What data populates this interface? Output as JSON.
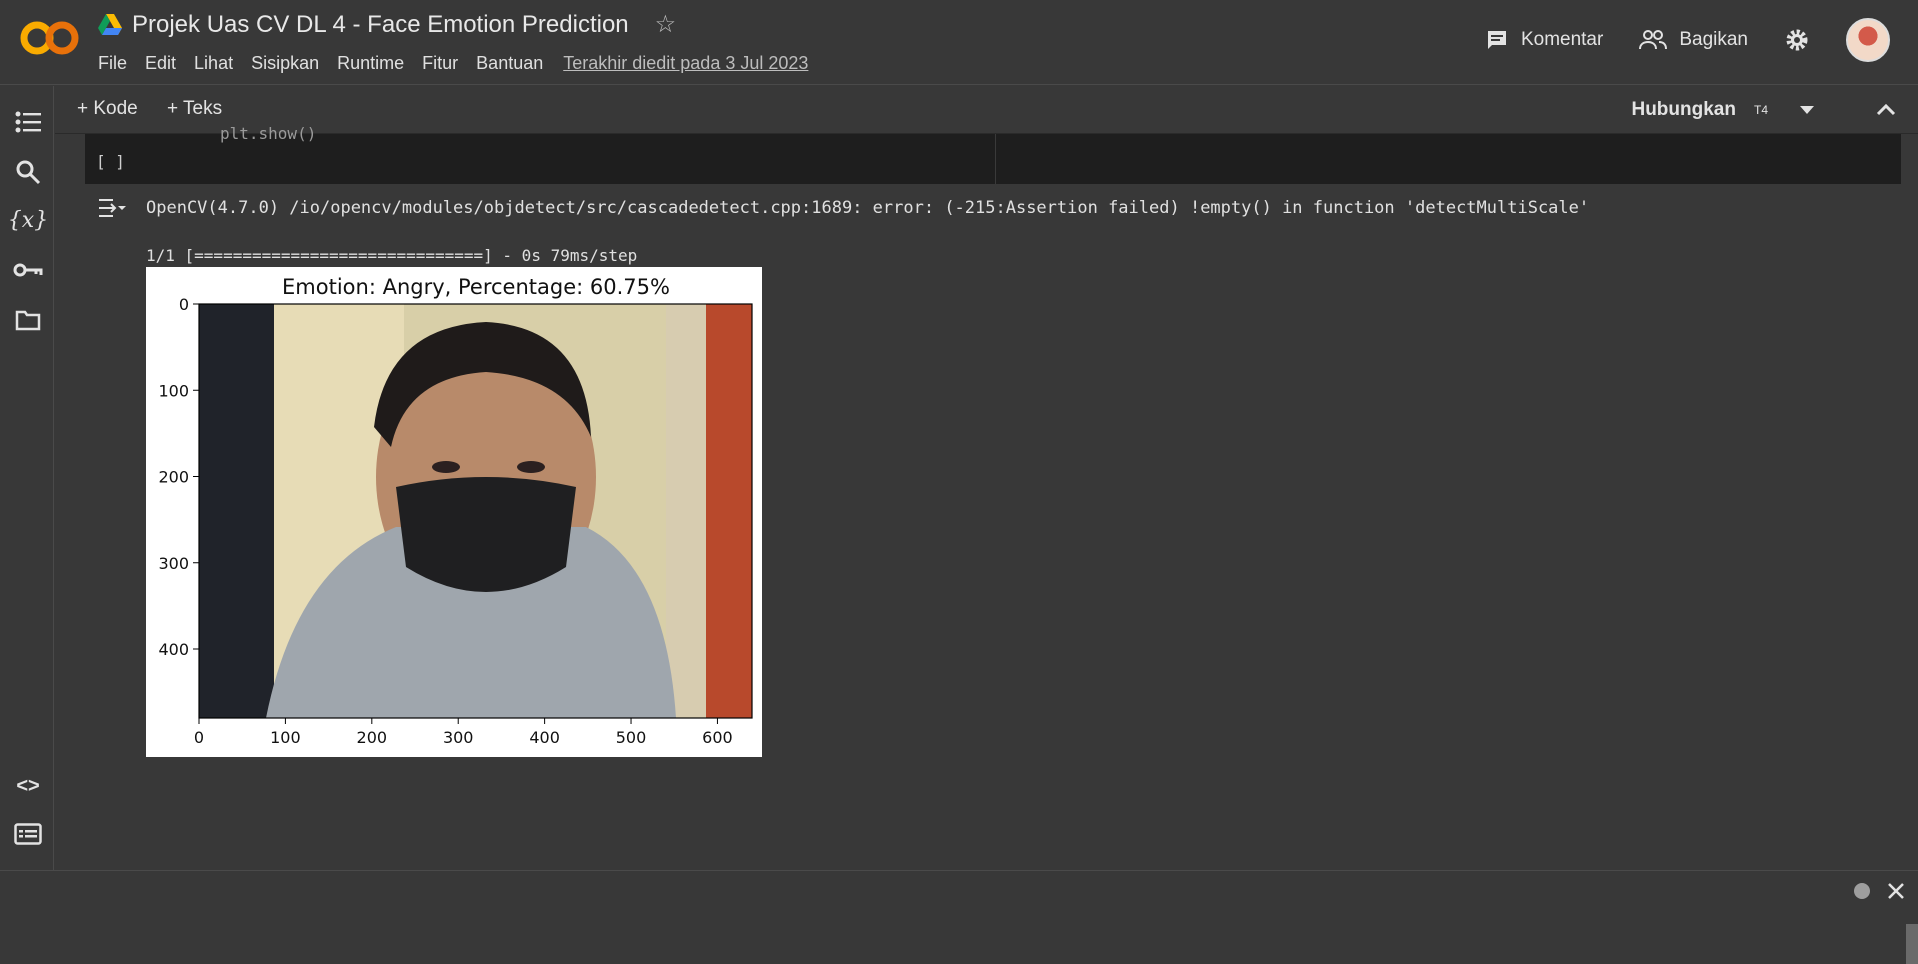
{
  "app": {
    "logo_text": "CO",
    "title": "Projek Uas CV DL 4 - Face Emotion Prediction"
  },
  "menu": [
    "File",
    "Edit",
    "Lihat",
    "Sisipkan",
    "Runtime",
    "Fitur",
    "Bantuan"
  ],
  "last_edit": "Terakhir diedit pada 3 Jul 2023",
  "top_actions": {
    "comment": "Komentar",
    "share": "Bagikan"
  },
  "toolbar": {
    "add_code": "+ Kode",
    "add_text": "+ Teks",
    "connect": "Hubungkan",
    "runtime_type": "T4"
  },
  "cell": {
    "code_partial": "plt.show()",
    "run_bracket": "[ ]"
  },
  "output": {
    "error_line": "OpenCV(4.7.0) /io/opencv/modules/objdetect/src/cascadedetect.cpp:1689: error: (-215:Assertion failed) !empty() in function 'detectMultiScale'",
    "progress_line": "1/1 [==============================] - 0s 79ms/step"
  },
  "chart_data": {
    "type": "image",
    "title": "Emotion: Angry, Percentage: 60.75%",
    "x_ticks": [
      "0",
      "100",
      "200",
      "300",
      "400",
      "500",
      "600"
    ],
    "y_ticks": [
      "0",
      "100",
      "200",
      "300",
      "400"
    ],
    "xlim": [
      0,
      640
    ],
    "ylim": [
      480,
      0
    ]
  },
  "sidebar_icons": [
    "toc-icon",
    "search-icon",
    "variables-icon",
    "key-icon",
    "folder-icon",
    "code-snippets-icon",
    "command-palette-icon",
    "terminal-icon"
  ],
  "colors": {
    "bg": "#383838",
    "cell_bg": "#1e1e1e",
    "accent_orange": "#f9ab00"
  }
}
